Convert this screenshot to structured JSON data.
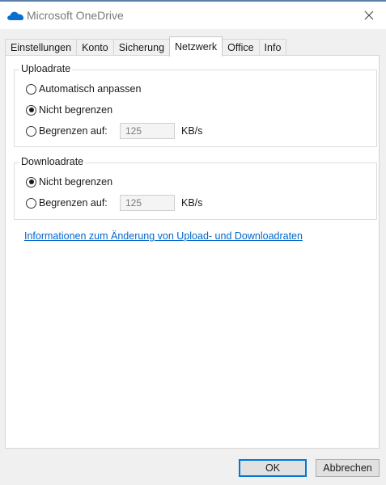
{
  "window": {
    "title": "Microsoft OneDrive",
    "icon": "onedrive-cloud-icon",
    "close_icon": "close-icon"
  },
  "tabs": [
    {
      "label": "Einstellungen",
      "active": false
    },
    {
      "label": "Konto",
      "active": false
    },
    {
      "label": "Sicherung",
      "active": false
    },
    {
      "label": "Netzwerk",
      "active": true
    },
    {
      "label": "Office",
      "active": false
    },
    {
      "label": "Info",
      "active": false
    }
  ],
  "upload": {
    "legend": "Uploadrate",
    "options": [
      {
        "label": "Automatisch anpassen",
        "checked": false
      },
      {
        "label": "Nicht begrenzen",
        "checked": true
      },
      {
        "label": "Begrenzen auf:",
        "checked": false
      }
    ],
    "limit_value": "125",
    "unit": "KB/s"
  },
  "download": {
    "legend": "Downloadrate",
    "options": [
      {
        "label": "Nicht begrenzen",
        "checked": true
      },
      {
        "label": "Begrenzen auf:",
        "checked": false
      }
    ],
    "limit_value": "125",
    "unit": "KB/s"
  },
  "info_link": "Informationen zum Änderung von Upload- und Downloadraten",
  "buttons": {
    "ok": "OK",
    "cancel": "Abbrechen"
  },
  "colors": {
    "accent": "#0078d7",
    "link": "#0066cc",
    "onedrive_blue": "#0a6ed1"
  }
}
